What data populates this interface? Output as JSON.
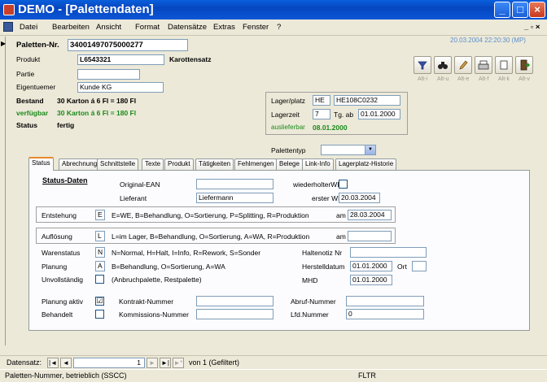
{
  "window": {
    "title": "DEMO - [Palettendaten]",
    "buttons": {
      "minimize": "_",
      "maximize": "□",
      "close": "×"
    }
  },
  "menu": {
    "items": [
      "Datei",
      "Bearbeiten",
      "Ansicht",
      "Format",
      "Datensätze",
      "Extras",
      "Fenster",
      "?"
    ],
    "right_controls": "_ ▫ ×"
  },
  "header": {
    "paletten_nr_label": "Paletten-Nr.",
    "paletten_nr_value": "34001497075000277",
    "produkt_label": "Produkt",
    "produkt_value": "L6543321",
    "produkt_desc": "Karottensatz",
    "partie_label": "Partie",
    "partie_value": "",
    "eigentuemer_label": "Eigentuemer",
    "eigentuemer_value": "Kunde KG",
    "bestand_label": "Bestand",
    "bestand_value": "30 Karton á 6 Fl = 180 Fl",
    "verfuegbar_label": "verfügbar",
    "verfuegbar_value": "30 Karton á 6 Fl = 180 Fl",
    "status_label": "Status",
    "status_value": "fertig",
    "timestamp": "20.03.2004 22:20:30 (MP)",
    "lager_label": "Lager/platz",
    "lager_value": "HE",
    "platz_value": "HE108C0232",
    "lagerzeit_label": "Lagerzeit",
    "lagerzeit_value": "7",
    "tg_ab_label": "Tg. ab",
    "tg_ab_value": "01.01.2000",
    "auslieferbar_label": "auslieferbar",
    "auslieferbar_value": "08.01.2000",
    "palettentyp_label": "Palettentyp",
    "palettentyp_value": ""
  },
  "toolbar": {
    "shortcuts": [
      "Alt-i",
      "Alt-u",
      "Alt-e",
      "Alt-f",
      "Alt-k",
      "Alt-v"
    ],
    "icons": [
      "filter-icon",
      "binoculars-icon",
      "edit-icon",
      "print-icon",
      "new-record-icon",
      "exit-icon"
    ]
  },
  "tabs": [
    "Status",
    "Abrechnung",
    "Schnittstelle",
    "Texte",
    "Produkt",
    "Tätigkeiten",
    "Fehlmengen",
    "Belege",
    "Link-Info",
    "Lagerplatz-Historie"
  ],
  "status_tab": {
    "section_title": "Status-Daten",
    "original_ean_label": "Original-EAN",
    "original_ean_value": "",
    "lieferant_label": "Lieferant",
    "lieferant_value": "Liefermann",
    "wiederholter_we_label": "wiederholterWE",
    "wiederholter_we_checked": "",
    "erster_we_label": "erster WE",
    "erster_we_value": "20.03.2004",
    "entstehung_label": "Entstehung",
    "entstehung_value": "E",
    "entstehung_desc": "E=WE, B=Behandlung, O=Sortierung, P=Splitting, R=Produktion",
    "entstehung_am_label": "am",
    "entstehung_am_value": "28.03.2004",
    "aufloesung_label": "Auflösung",
    "aufloesung_value": "L",
    "aufloesung_desc": "L=im Lager, B=Behandlung, O=Sortierung, A=WA, R=Produktion",
    "aufloesung_am_label": "am",
    "aufloesung_am_value": "",
    "warenstatus_label": "Warenstatus",
    "warenstatus_value": "N",
    "warenstatus_desc": "N=Normal, H=Halt, I=Info, R=Rework, S=Sonder",
    "haltenotiz_label": "Haltenotiz Nr",
    "haltenotiz_value": "",
    "planung_label": "Planung",
    "planung_value": "A",
    "planung_desc": "B=Behandlung, O=Sortierung, A=WA",
    "herstelldatum_label": "Herstelldatum",
    "herstelldatum_value": "01.01.2000",
    "ort_label": "Ort",
    "ort_value": "",
    "unvollstaendig_label": "Unvollständig",
    "unvollstaendig_checked": "",
    "unvollstaendig_desc": "(Anbruchpalette, Restpalette)",
    "mhd_label": "MHD",
    "mhd_value": "01.01.2000",
    "planung_aktiv_label": "Planung aktiv",
    "planung_aktiv_checked": "☑",
    "kontrakt_label": "Kontrakt-Nummer",
    "kontrakt_value": "",
    "abruf_label": "Abruf-Nummer",
    "abruf_value": "",
    "behandelt_label": "Behandelt",
    "behandelt_checked": "",
    "kommissions_label": "Kommissions-Nummer",
    "kommissions_value": "",
    "lfd_label": "Lfd.Nummer",
    "lfd_value": "0"
  },
  "navigation": {
    "label": "Datensatz:",
    "current": "1",
    "of_text": "von 1 (Gefiltert)",
    "buttons": [
      "|◄",
      "◄",
      "►",
      "►|",
      "►*"
    ]
  },
  "statusbar": {
    "text": "Paletten-Nummer, betrieblich (SSCC)",
    "mode": "FLTR"
  },
  "colors": {
    "titlebar": "#0a5fdc",
    "green_text": "#1a8a1a",
    "timestamp": "#5a8fd0",
    "active_tab_accent": "#e68b2c"
  }
}
